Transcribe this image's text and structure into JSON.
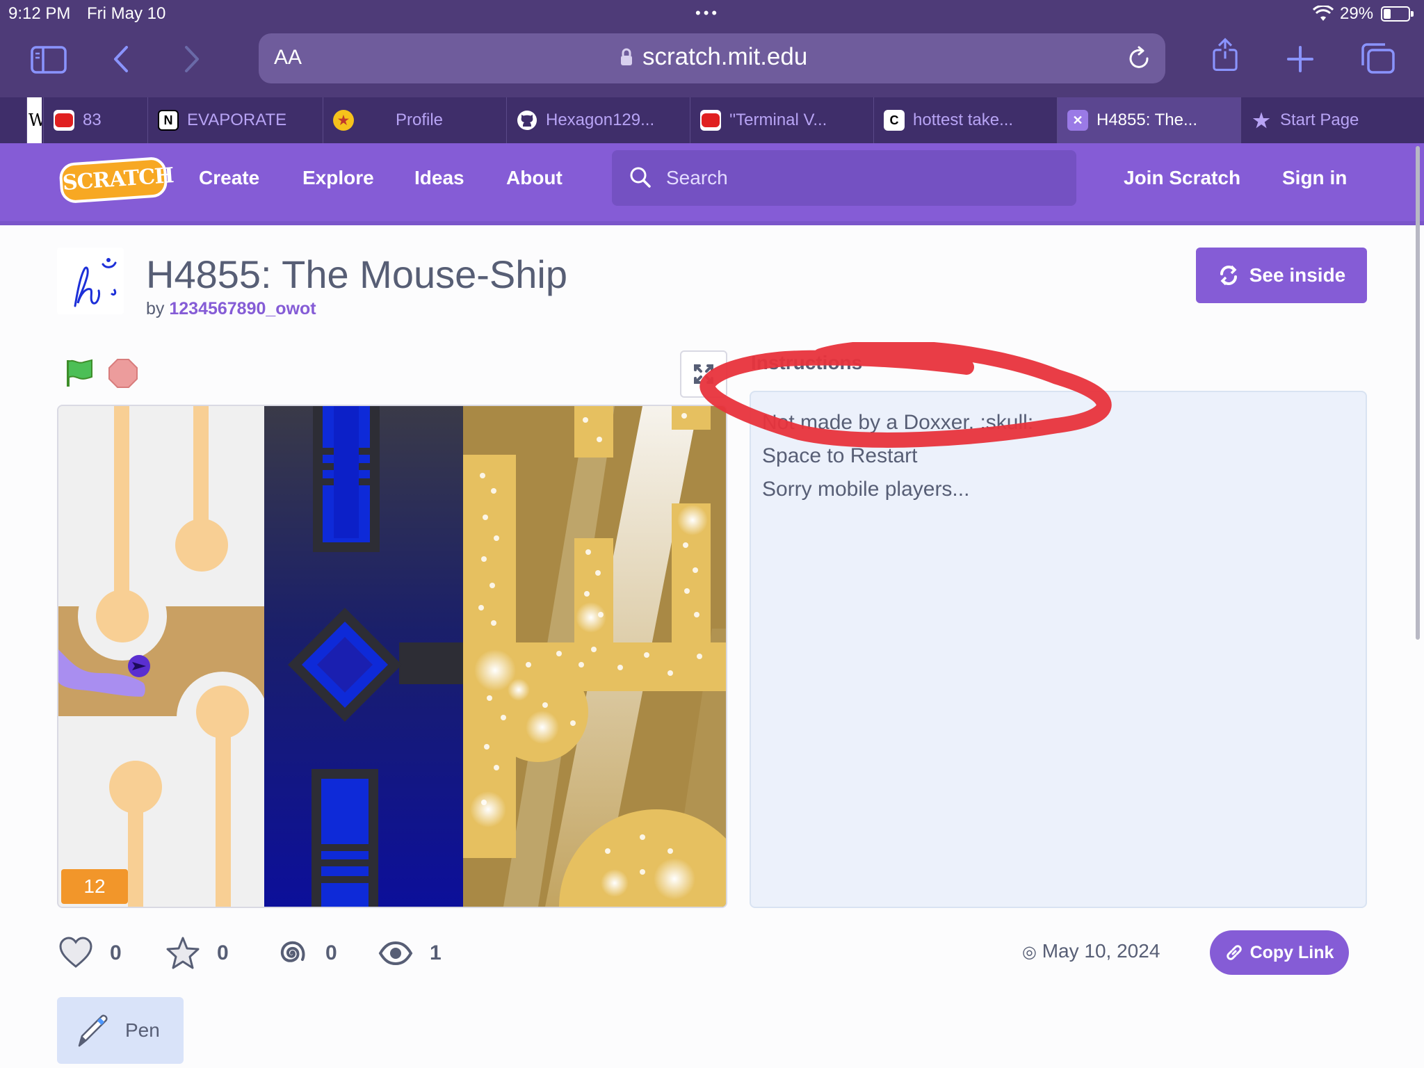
{
  "status_bar": {
    "time": "9:12 PM",
    "date": "Fri May 10",
    "battery": "29%"
  },
  "browser": {
    "text_size_label": "AA",
    "url": "scratch.mit.edu",
    "tabs": [
      {
        "label": "",
        "icon": "wikipedia-icon"
      },
      {
        "label": "83",
        "icon": "youtube-icon"
      },
      {
        "label": "EVAPORATE",
        "icon": "notion-icon"
      },
      {
        "label": "Profile",
        "icon": "star-badge-icon"
      },
      {
        "label": "Hexagon129...",
        "icon": "github-icon"
      },
      {
        "label": "''Terminal V...",
        "icon": "youtube-icon"
      },
      {
        "label": "hottest take...",
        "icon": "c-icon"
      },
      {
        "label": "H4855: The...",
        "icon": "scratch-tab-icon"
      },
      {
        "label": "Start Page",
        "icon": "star-icon"
      }
    ]
  },
  "scratch_nav": {
    "logo": "SCRATCH",
    "links": [
      "Create",
      "Explore",
      "Ideas",
      "About"
    ],
    "search_placeholder": "Search",
    "join": "Join Scratch",
    "sign_in": "Sign in"
  },
  "project": {
    "title": "H4855: The Mouse-Ship",
    "by_label": "by",
    "author": "1234567890_owot",
    "see_inside": "See inside",
    "counter": "12"
  },
  "instructions": {
    "heading": "Instructions",
    "lines": [
      "Not made by a Doxxer. :skull:",
      "Space to Restart",
      "Sorry mobile players..."
    ]
  },
  "stats": {
    "loves": "0",
    "favorites": "0",
    "remixes": "0",
    "views": "1",
    "date": "May 10, 2024",
    "copy_link": "Copy Link"
  },
  "extensions": {
    "pen": "Pen"
  },
  "colors": {
    "scratch_purple": "#855cd6",
    "safari_bar": "#4e3b78",
    "annotation_red": "#e8333c",
    "counter_orange": "#f2962a"
  }
}
